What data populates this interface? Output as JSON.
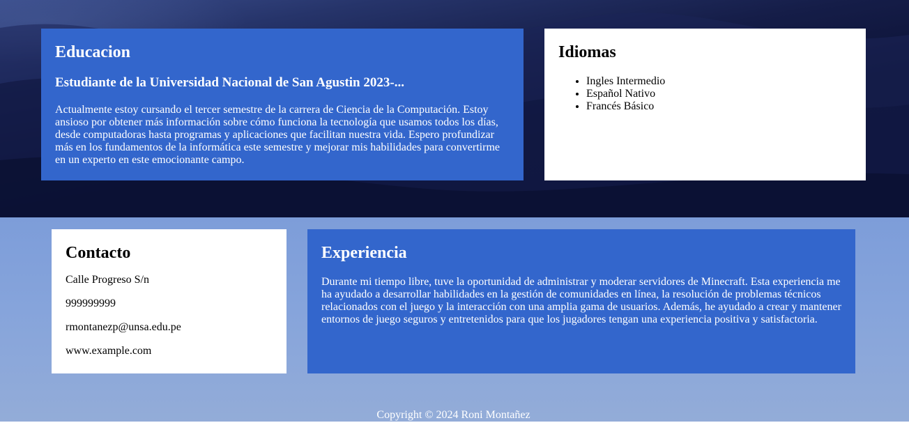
{
  "colors": {
    "card_blue": "#3366cc",
    "card_white": "#ffffff",
    "text_on_blue": "#ffffff",
    "text_on_white": "#000000"
  },
  "educacion": {
    "title": "Educacion",
    "subtitle": "Estudiante de la Universidad Nacional de San Agustin 2023-...",
    "body": "Actualmente estoy cursando el tercer semestre de la carrera de Ciencia de la Computación. Estoy ansioso por obtener más información sobre cómo funciona la tecnología que usamos todos los días, desde computadoras hasta programas y aplicaciones que facilitan nuestra vida. Espero profundizar más en los fundamentos de la informática este semestre y mejorar mis habilidades para convertirme en un experto en este emocionante campo."
  },
  "idiomas": {
    "title": "Idiomas",
    "items": [
      "Ingles Intermedio",
      "Español Nativo",
      "Francés Básico"
    ]
  },
  "contacto": {
    "title": "Contacto",
    "address": "Calle Progreso S/n",
    "phone": "999999999",
    "email": "rmontanezp@unsa.edu.pe",
    "website": "www.example.com"
  },
  "experiencia": {
    "title": "Experiencia",
    "body": "Durante mi tiempo libre, tuve la oportunidad de administrar y moderar servidores de Minecraft. Esta experiencia me ha ayudado a desarrollar habilidades en la gestión de comunidades en línea, la resolución de problemas técnicos relacionados con el juego y la interacción con una amplia gama de usuarios. Además, he ayudado a crear y mantener entornos de juego seguros y entretenidos para que los jugadores tengan una experiencia positiva y satisfactoria."
  },
  "footer": {
    "copyright": "Copyright © 2024 Roni Montañez"
  }
}
